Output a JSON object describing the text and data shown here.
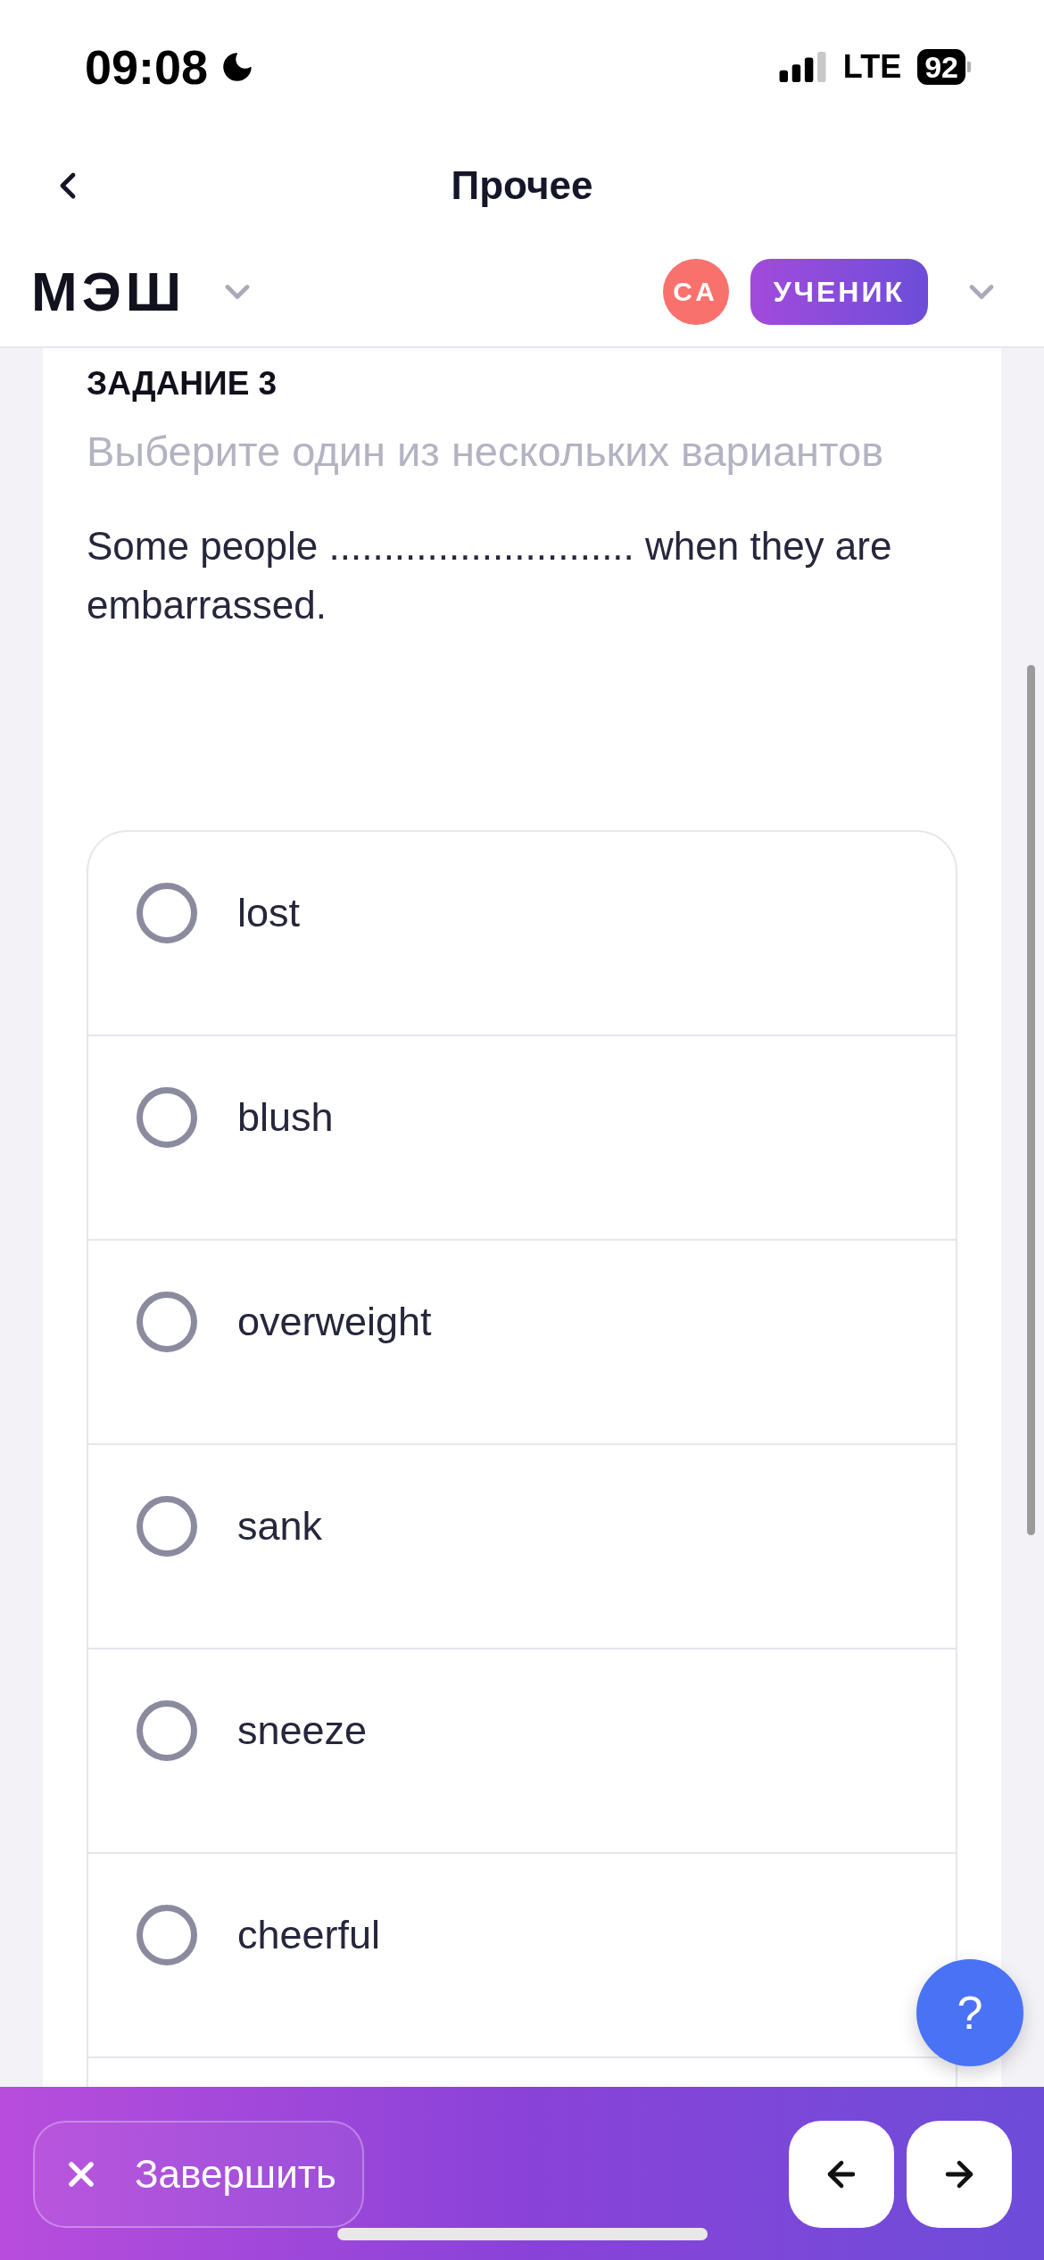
{
  "status_bar": {
    "time": "09:08",
    "network": "LTE",
    "battery": "92"
  },
  "nav_bar": {
    "title": "Прочее"
  },
  "app_header": {
    "logo": "МЭШ",
    "avatar_initials": "СА",
    "role": "УЧЕНИК"
  },
  "task": {
    "heading": "ЗАДАНИЕ 3",
    "instruction": "Выберите один из нескольких вариантов",
    "question": "Some people ............................ when they are embarrassed.",
    "options": [
      {
        "label": "lost",
        "selected": false
      },
      {
        "label": "blush",
        "selected": false
      },
      {
        "label": "overweight",
        "selected": false
      },
      {
        "label": "sank",
        "selected": false
      },
      {
        "label": "sneeze",
        "selected": false
      },
      {
        "label": "cheerful",
        "selected": false
      }
    ]
  },
  "help_button": {
    "label": "?"
  },
  "bottom_bar": {
    "finish_button": "Завершить"
  }
}
